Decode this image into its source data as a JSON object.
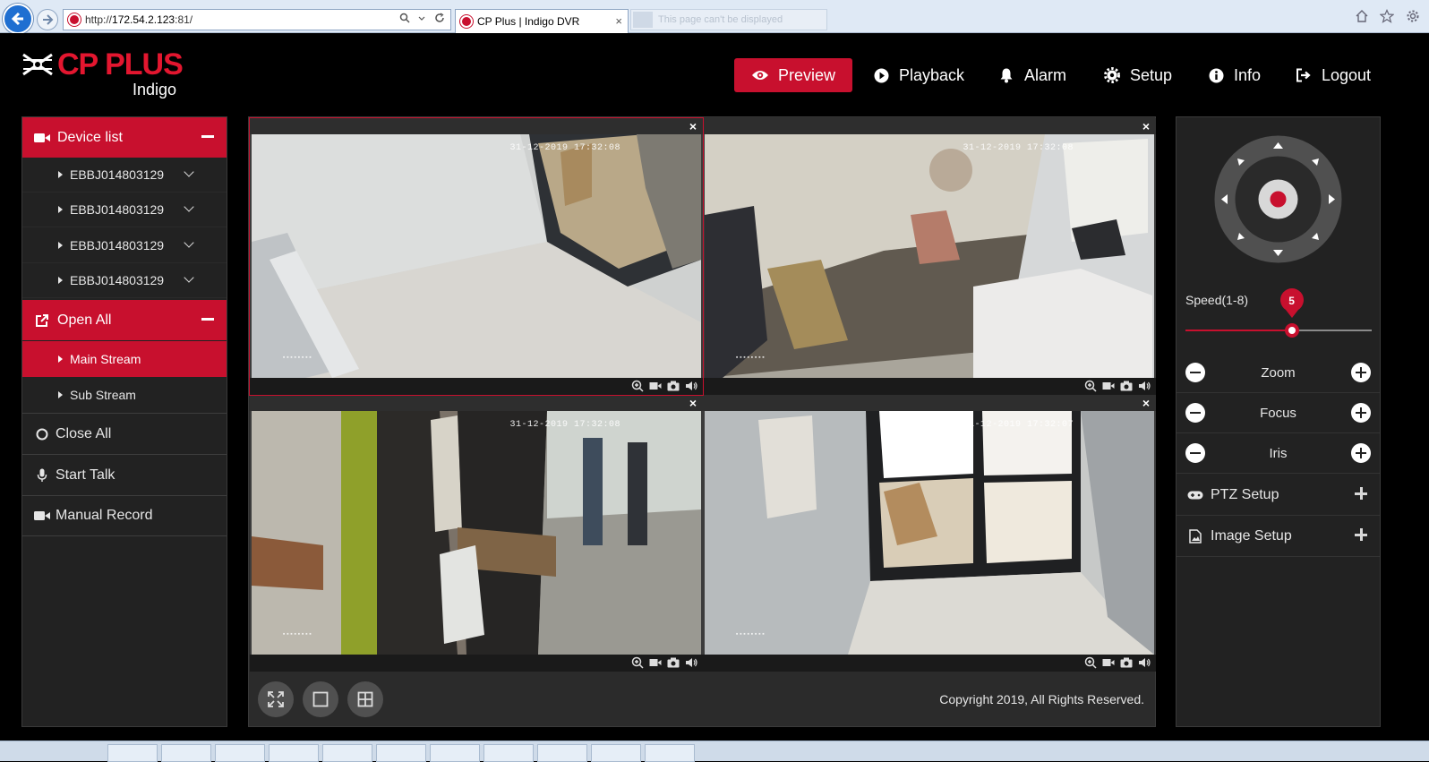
{
  "browser": {
    "url_prefix": "http://",
    "url_host": "172.54.2.123",
    "url_suffix": ":81/",
    "tab_title": "CP Plus | Indigo DVR",
    "inactive_tab_title": "This page can't be displayed",
    "tab_close": "×"
  },
  "app": {
    "logo_text": "CP PLUS",
    "logo_sub": "Indigo",
    "accent_color": "#c8102e"
  },
  "nav": {
    "preview": "Preview",
    "playback": "Playback",
    "alarm": "Alarm",
    "setup": "Setup",
    "info": "Info",
    "logout": "Logout"
  },
  "left": {
    "device_list": "Device list",
    "devices": [
      "EBBJ014803129",
      "EBBJ014803129",
      "EBBJ014803129",
      "EBBJ014803129"
    ],
    "open_all": "Open All",
    "main_stream": "Main Stream",
    "sub_stream": "Sub Stream",
    "close_all": "Close All",
    "start_talk": "Start Talk",
    "manual_record": "Manual Record"
  },
  "tiles": {
    "close": "×",
    "timestamps": [
      "31-12-2019 17:32:08",
      "31-12-2019 17:32:08",
      "31-12-2019 17:32:08",
      "31-12-2019 17:32:07"
    ]
  },
  "footer": {
    "copyright": "Copyright 2019, All Rights Reserved."
  },
  "right": {
    "speed_label": "Speed(1-8)",
    "speed_value": "5",
    "speed_fraction": 0.57,
    "zoom": "Zoom",
    "focus": "Focus",
    "iris": "Iris",
    "ptz_setup": "PTZ Setup",
    "image_setup": "Image Setup"
  }
}
